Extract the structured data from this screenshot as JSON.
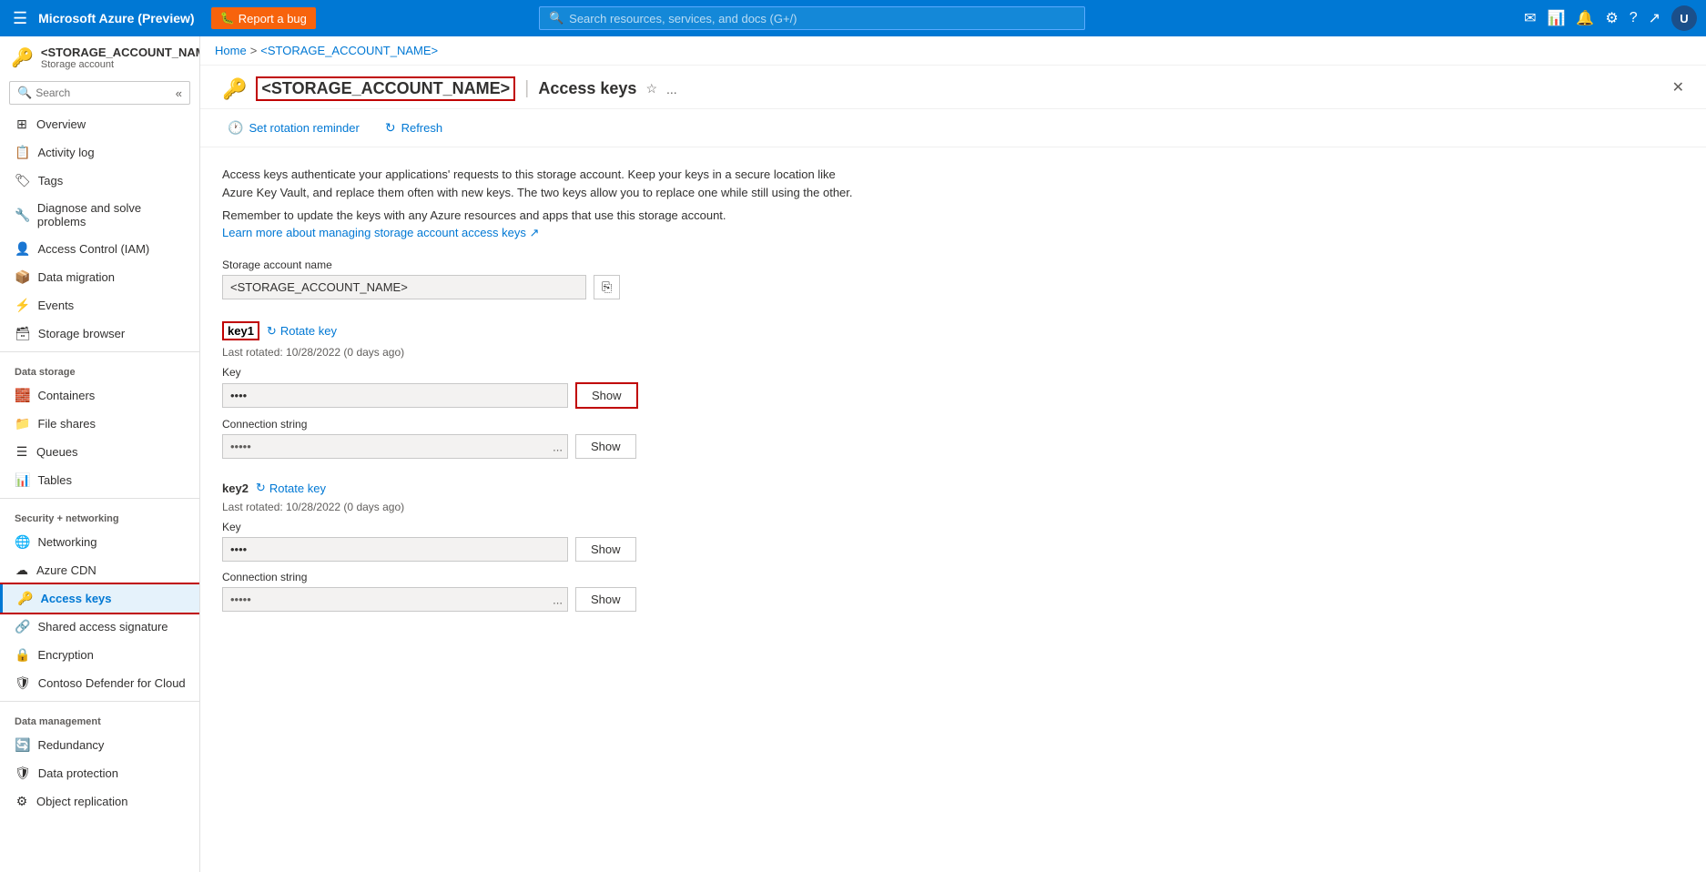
{
  "topbar": {
    "hamburger": "☰",
    "logo": "Microsoft Azure (Preview)",
    "bug_btn_icon": "🐛",
    "bug_btn_label": "Report a bug",
    "search_placeholder": "Search resources, services, and docs (G+/)",
    "icons": [
      "✉",
      "📊",
      "🔔",
      "⚙",
      "?",
      "↗"
    ],
    "avatar_initials": "U"
  },
  "breadcrumb": {
    "home": "Home",
    "separator1": ">",
    "account": "<STORAGE_ACCOUNT_NAME>",
    "separator2": ""
  },
  "page_header": {
    "resource_name": "<STORAGE_ACCOUNT_NAME>",
    "separator": "|",
    "title": "Access keys",
    "star_icon": "☆",
    "ellipsis": "...",
    "close_icon": "✕"
  },
  "toolbar": {
    "set_rotation_icon": "🕐",
    "set_rotation_label": "Set rotation reminder",
    "refresh_icon": "↻",
    "refresh_label": "Refresh"
  },
  "sidebar": {
    "search_placeholder": "Search",
    "resource_icon": "🔑",
    "resource_name": "<STORAGE_ACCOUNT_NAME>",
    "resource_type": "Storage account",
    "nav_items": [
      {
        "id": "overview",
        "icon": "⊞",
        "label": "Overview"
      },
      {
        "id": "activity-log",
        "icon": "📋",
        "label": "Activity log"
      },
      {
        "id": "tags",
        "icon": "🏷",
        "label": "Tags"
      },
      {
        "id": "diagnose",
        "icon": "🔧",
        "label": "Diagnose and solve problems"
      },
      {
        "id": "access-control",
        "icon": "👤",
        "label": "Access Control (IAM)"
      },
      {
        "id": "data-migration",
        "icon": "📦",
        "label": "Data migration"
      },
      {
        "id": "events",
        "icon": "⚡",
        "label": "Events"
      },
      {
        "id": "storage-browser",
        "icon": "🗃",
        "label": "Storage browser"
      }
    ],
    "data_storage_section": "Data storage",
    "data_storage_items": [
      {
        "id": "containers",
        "icon": "🧱",
        "label": "Containers"
      },
      {
        "id": "file-shares",
        "icon": "📁",
        "label": "File shares"
      },
      {
        "id": "queues",
        "icon": "☰",
        "label": "Queues"
      },
      {
        "id": "tables",
        "icon": "📊",
        "label": "Tables"
      }
    ],
    "security_section": "Security + networking",
    "security_items": [
      {
        "id": "networking",
        "icon": "🌐",
        "label": "Networking"
      },
      {
        "id": "azure-cdn",
        "icon": "☁",
        "label": "Azure CDN"
      },
      {
        "id": "access-keys",
        "icon": "🔑",
        "label": "Access keys",
        "active": true
      },
      {
        "id": "shared-access",
        "icon": "🔗",
        "label": "Shared access signature"
      },
      {
        "id": "encryption",
        "icon": "🔒",
        "label": "Encryption"
      },
      {
        "id": "defender",
        "icon": "🛡",
        "label": "Contoso Defender for Cloud"
      }
    ],
    "data_mgmt_section": "Data management",
    "data_mgmt_items": [
      {
        "id": "redundancy",
        "icon": "🔄",
        "label": "Redundancy"
      },
      {
        "id": "data-protection",
        "icon": "🛡",
        "label": "Data protection"
      },
      {
        "id": "object-replication",
        "icon": "⚙",
        "label": "Object replication"
      }
    ]
  },
  "content": {
    "description1": "Access keys authenticate your applications' requests to this storage account. Keep your keys in a secure location like Azure Key Vault, and replace them often with new keys. The two keys allow you to replace one while still using the other.",
    "reminder": "Remember to update the keys with any Azure resources and apps that use this storage account.",
    "learn_more": "Learn more about managing storage account access keys ↗",
    "storage_account_label": "Storage account name",
    "storage_account_name": "<STORAGE_ACCOUNT_NAME>",
    "copy_icon": "⎘",
    "key1": {
      "label": "key1",
      "rotate_icon": "↻",
      "rotate_label": "Rotate key",
      "last_rotated": "Last rotated: 10/28/2022 (0 days ago)",
      "key_label": "Key",
      "key_placeholder": "••••",
      "show_label": "Show",
      "connection_label": "Connection string",
      "connection_placeholder": "•••••",
      "connection_ellipsis": "...",
      "connection_show": "Show"
    },
    "key2": {
      "label": "key2",
      "rotate_icon": "↻",
      "rotate_label": "Rotate key",
      "last_rotated": "Last rotated: 10/28/2022 (0 days ago)",
      "key_label": "Key",
      "key_placeholder": "••••",
      "show_label": "Show",
      "connection_label": "Connection string",
      "connection_placeholder": "•••••",
      "connection_ellipsis": "...",
      "connection_show": "Show"
    }
  }
}
